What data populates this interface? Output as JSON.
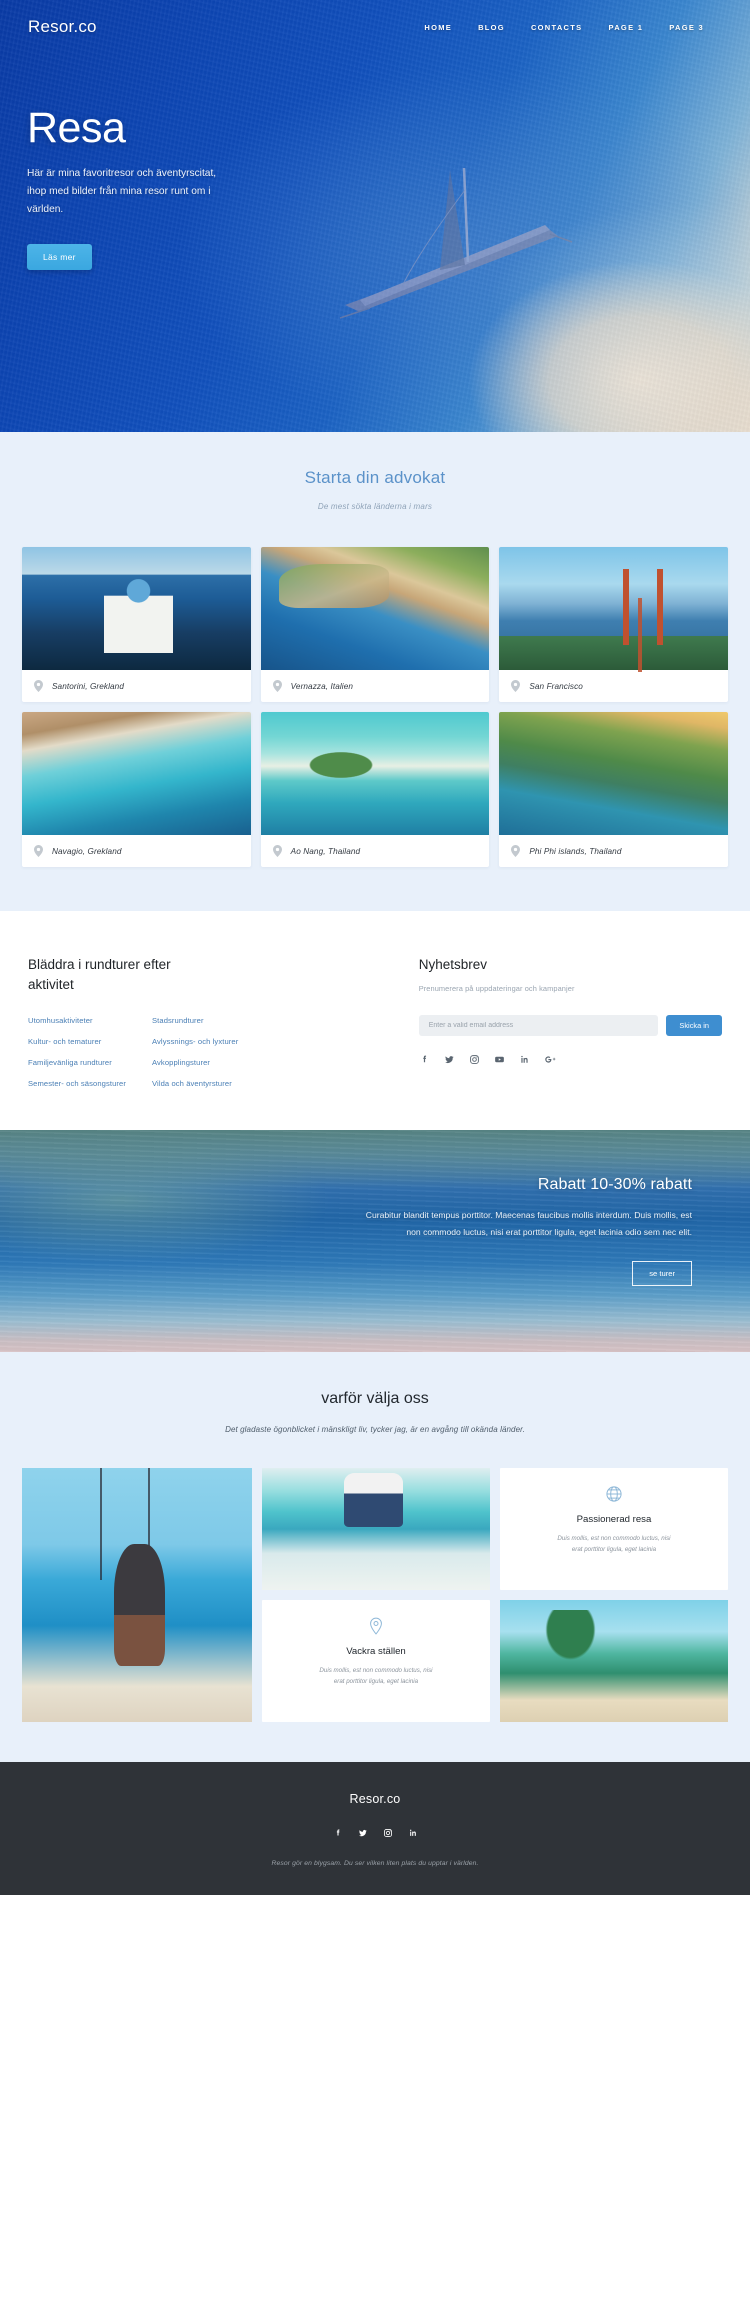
{
  "header": {
    "brand": "Resor.co",
    "nav": [
      {
        "label": "HOME",
        "name": "nav-home"
      },
      {
        "label": "BLOG",
        "name": "nav-blog"
      },
      {
        "label": "CONTACTS",
        "name": "nav-contacts"
      },
      {
        "label": "PAGE 1",
        "name": "nav-page-1"
      },
      {
        "label": "PAGE 3",
        "name": "nav-page-3"
      }
    ]
  },
  "hero": {
    "title": "Resa",
    "subtitle": "Här är mina favoritresor och äventyrscitat, ihop med bilder från mina resor runt om i världen.",
    "button": "Läs mer"
  },
  "gallery": {
    "title": "Starta din advokat",
    "subtitle": "De mest sökta länderna i mars",
    "items": [
      {
        "caption": "Santorini, Grekland"
      },
      {
        "caption": "Vernazza, Italien"
      },
      {
        "caption": "San Francisco"
      },
      {
        "caption": "Navagio, Grekland"
      },
      {
        "caption": "Ao Nang, Thailand"
      },
      {
        "caption": "Phi Phi islands, Thailand"
      }
    ]
  },
  "tours": {
    "title": "Bläddra i rundturer efter aktivitet",
    "column_one": [
      "Utomhusaktiviteter",
      "Kultur- och tematurer",
      "Familjevänliga rundturer",
      "Semester- och säsongsturer"
    ],
    "column_two": [
      "Stadsrundturer",
      "Avlyssnings- och lyxturer",
      "Avkopplingsturer",
      "Vilda och äventyrsturer"
    ]
  },
  "newsletter": {
    "title": "Nyhetsbrev",
    "subtitle": "Prenumerera på uppdateringar och kampanjer",
    "placeholder": "Enter a valid email address",
    "input_value": "",
    "button": "Skicka in",
    "socials": [
      "facebook-icon",
      "twitter-icon",
      "instagram-icon",
      "youtube-icon",
      "linkedin-icon",
      "google-plus-icon"
    ]
  },
  "banner": {
    "title": "Rabatt 10-30% rabatt",
    "text": "Curabitur blandit tempus porttitor. Maecenas faucibus mollis interdum. Duis mollis, est non commodo luctus, nisi erat porttitor ligula, eget lacinia odio sem nec elit.",
    "button": "se turer"
  },
  "why": {
    "title": "varför välja oss",
    "subtitle": "Det gladaste ögonblicket i mänskligt liv, tycker jag, är en avgång till okända länder.",
    "cards": [
      {
        "icon": "globe-icon",
        "title": "Passionerad resa",
        "text": "Duis mollis, est non commodo luctus, nisi erat porttitor ligula, eget lacinia"
      },
      {
        "icon": "map-pin-icon",
        "title": "Vackra ställen",
        "text": "Duis mollis, est non commodo luctus, nisi erat porttitor ligula, eget lacinia"
      }
    ]
  },
  "footer": {
    "brand": "Resor.co",
    "socials": [
      "facebook-icon",
      "twitter-icon",
      "instagram-icon",
      "linkedin-icon"
    ],
    "note": "Resor gör en blygsam. Du ser vilken liten plats du upptar i världen."
  },
  "colors": {
    "accent_blue": "#3e8ed0",
    "section_bg": "#e8f0fa",
    "footer_bg": "#2f3338",
    "heading_blue": "#5b92c9"
  }
}
